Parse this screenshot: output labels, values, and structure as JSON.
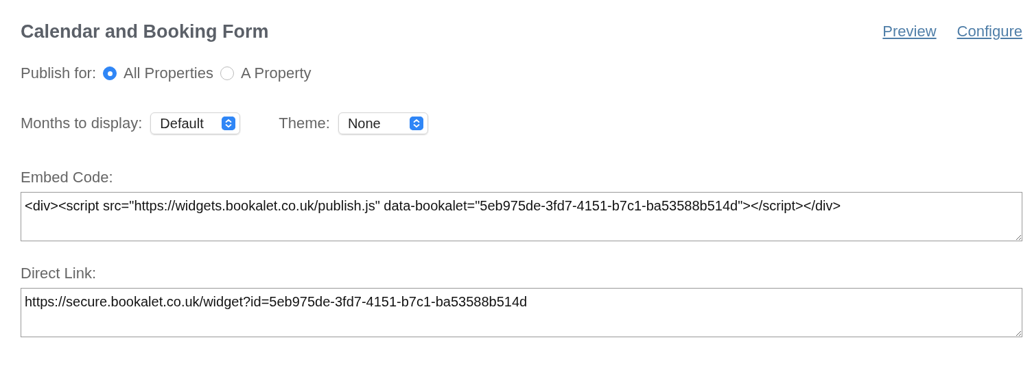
{
  "header": {
    "title": "Calendar and Booking Form",
    "links": [
      "Preview",
      "Configure"
    ]
  },
  "publish_for": {
    "label": "Publish for:",
    "options": [
      {
        "label": "All Properties",
        "selected": true
      },
      {
        "label": "A Property",
        "selected": false
      }
    ]
  },
  "selects": [
    {
      "label": "Months to display:",
      "value": "Default"
    },
    {
      "label": "Theme:",
      "value": "None"
    }
  ],
  "fields": [
    {
      "label": "Embed Code:",
      "value": "<div><script src=\"https://widgets.bookalet.co.uk/publish.js\" data-bookalet=\"5eb975de-3fd7-4151-b7c1-ba53588b514d\"></script></div>"
    },
    {
      "label": "Direct Link:",
      "value": "https://secure.bookalet.co.uk/widget?id=5eb975de-3fd7-4151-b7c1-ba53588b514d"
    }
  ]
}
